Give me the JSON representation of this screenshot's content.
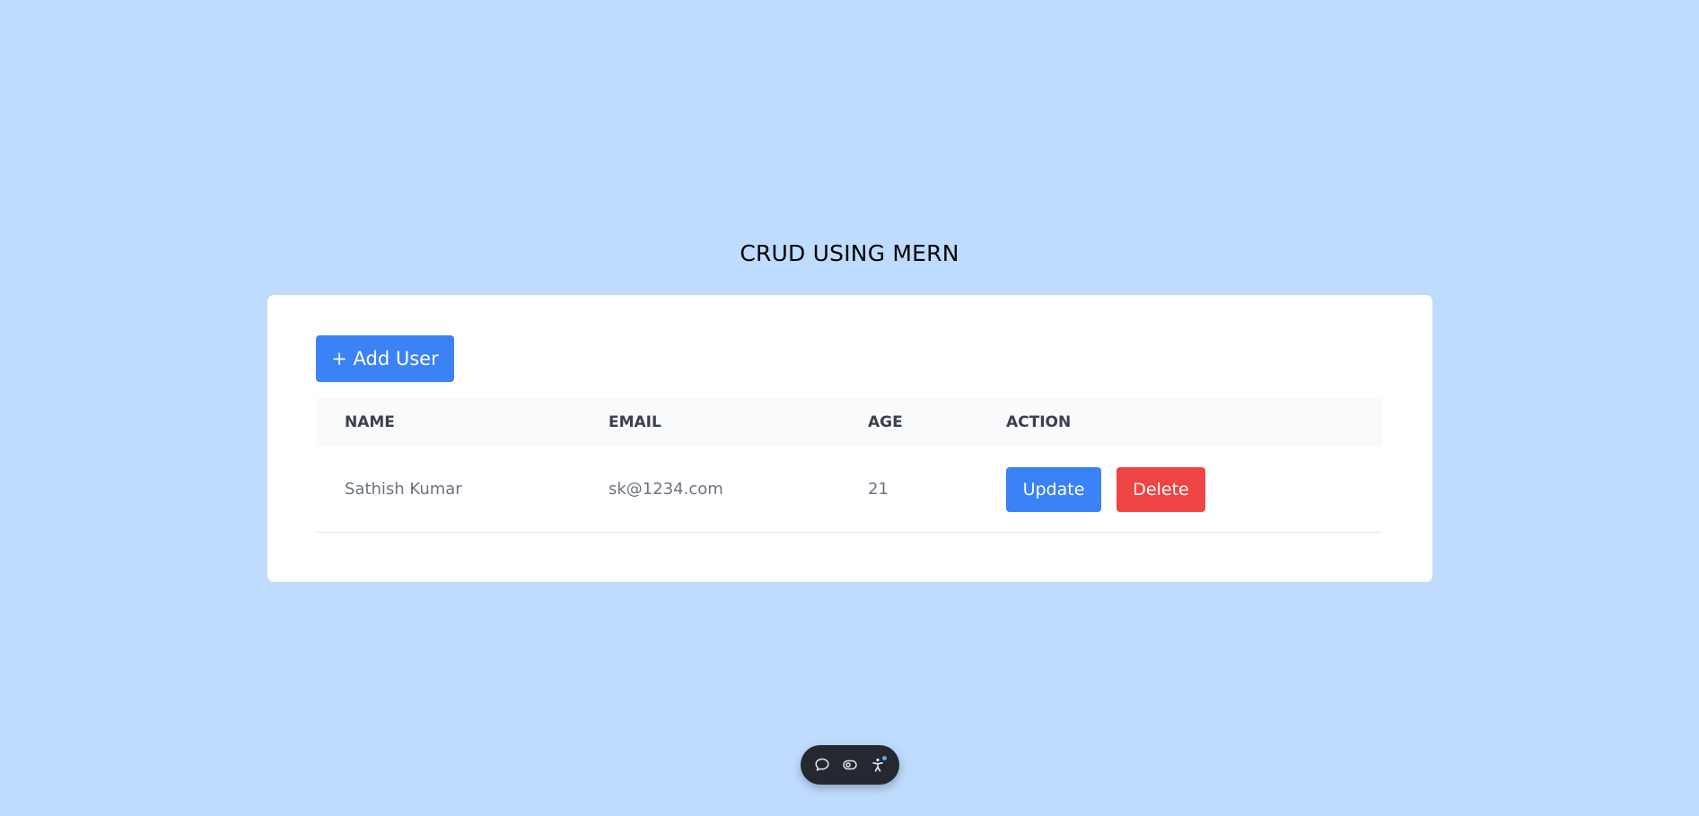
{
  "page": {
    "title": "CRUD USING MERN"
  },
  "toolbar": {
    "add_user_label": "+ Add User"
  },
  "table": {
    "headers": {
      "name": "NAME",
      "email": "EMAIL",
      "age": "AGE",
      "action": "ACTION"
    },
    "rows": [
      {
        "name": "Sathish Kumar",
        "email": "sk@1234.com",
        "age": "21",
        "update_label": "Update",
        "delete_label": "Delete"
      }
    ]
  },
  "floating_toolbar": {
    "icons": [
      "comment-icon",
      "eye-toggle-icon",
      "accessibility-icon"
    ]
  },
  "colors": {
    "background": "#bfdbfe",
    "primary": "#3b82f6",
    "danger": "#ef4444",
    "toolbar": "#25282e"
  }
}
